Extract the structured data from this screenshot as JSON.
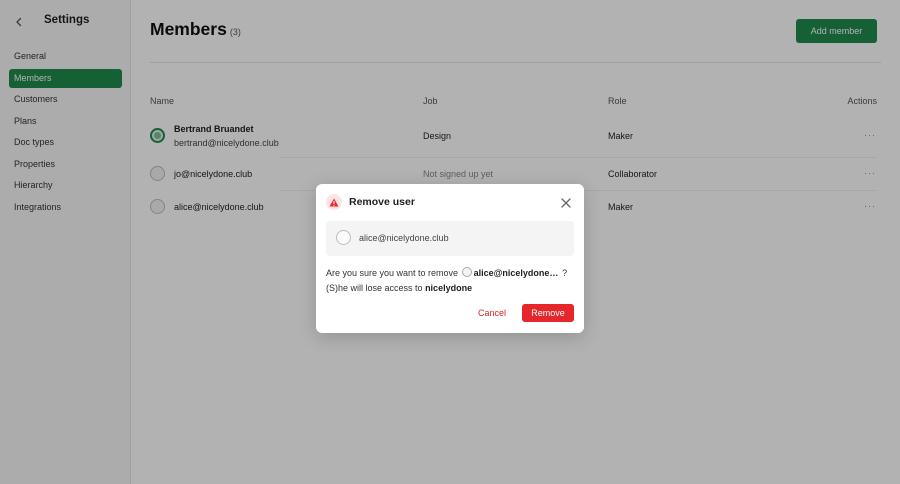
{
  "sidebar": {
    "title": "Settings",
    "items": [
      {
        "label": "General"
      },
      {
        "label": "Members"
      },
      {
        "label": "Customers"
      },
      {
        "label": "Plans"
      },
      {
        "label": "Doc types"
      },
      {
        "label": "Properties"
      },
      {
        "label": "Hierarchy"
      },
      {
        "label": "Integrations"
      }
    ]
  },
  "header": {
    "title": "Members",
    "count": "(3)",
    "add_button_label": "Add member"
  },
  "table": {
    "columns": {
      "name": "Name",
      "job": "Job",
      "role": "Role",
      "actions": "Actions"
    },
    "rows": [
      {
        "name": "Bertrand Bruandet",
        "email": "bertrand@nicelydone.club",
        "job": "Design",
        "role": "Maker",
        "actions": "···"
      },
      {
        "name": "jo@nicelydone.club",
        "job": "Not signed up yet",
        "role": "Collaborator",
        "actions": "···"
      },
      {
        "name": "alice@nicelydone.club",
        "job": "",
        "role": "Maker",
        "actions": "···"
      }
    ]
  },
  "modal": {
    "title": "Remove user",
    "user_email": "alice@nicelydone.club",
    "confirm_prefix": "Are you sure you want to remove",
    "confirm_user": "alice@nicelydone.c...",
    "confirm_suffix": "?",
    "lose_access_prefix": "(S)he will lose access to",
    "workspace": "nicelydone",
    "cancel_label": "Cancel",
    "remove_label": "Remove"
  },
  "colors": {
    "accent": "#1f8a4c",
    "danger": "#e5262b"
  }
}
